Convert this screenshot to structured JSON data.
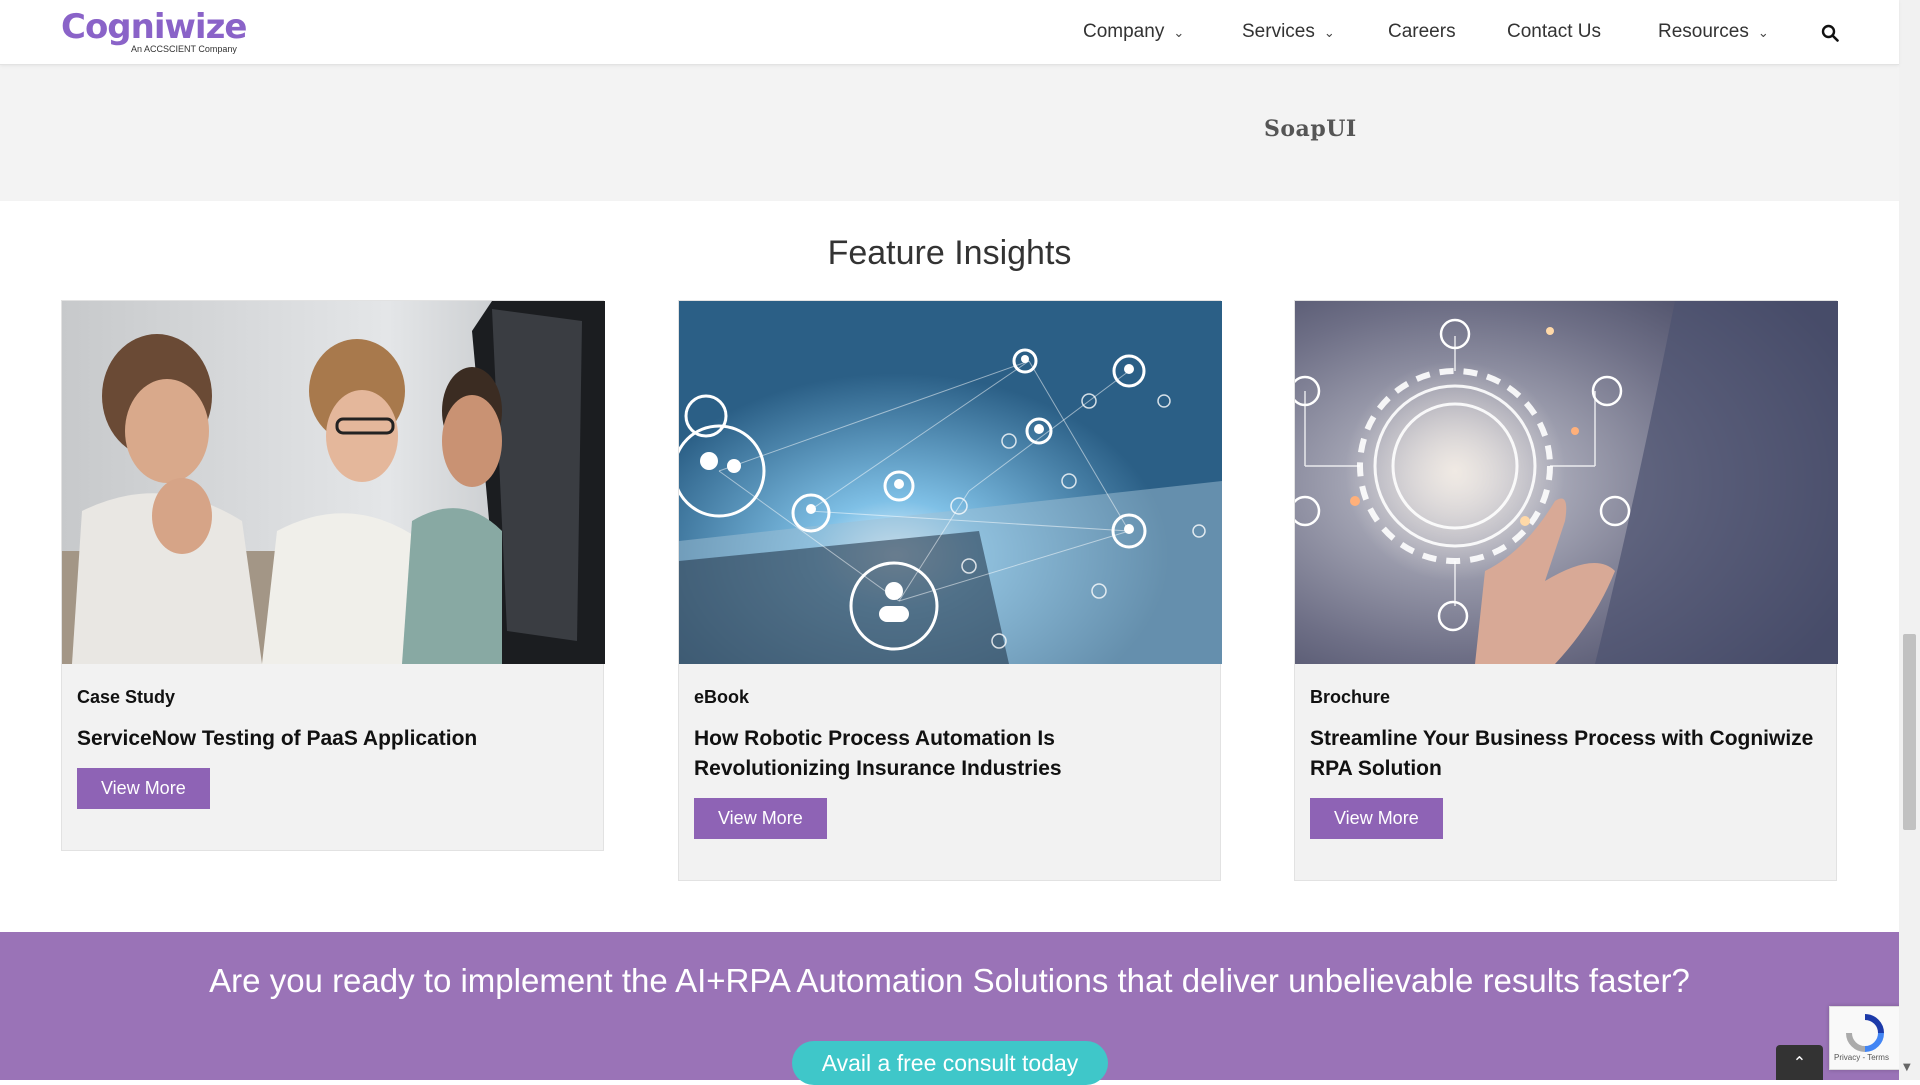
{
  "header": {
    "logo_text": "Cogniwize",
    "logo_subtext": "An ACCSCIENT Company",
    "nav": [
      {
        "label": "Company",
        "has_dropdown": true
      },
      {
        "label": "Services",
        "has_dropdown": true
      },
      {
        "label": "Careers",
        "has_dropdown": false
      },
      {
        "label": "Contact Us",
        "has_dropdown": false
      },
      {
        "label": "Resources",
        "has_dropdown": true
      }
    ],
    "search_icon": "search-icon"
  },
  "top_band": {
    "tool_label": "SoapUI"
  },
  "insights": {
    "title": "Feature Insights",
    "cards": [
      {
        "type": "Case Study",
        "title": "ServiceNow Testing of PaaS Application",
        "button": "View More",
        "image": "people-at-computer-photo"
      },
      {
        "type": "eBook",
        "title": "How Robotic Process Automation Is Revolutionizing Insurance Industries",
        "button": "View More",
        "image": "network-user-icons-photo"
      },
      {
        "type": "Brochure",
        "title": "Streamline Your Business Process with Cogniwize RPA Solution",
        "button": "View More",
        "image": "hand-holding-gear-photo"
      }
    ]
  },
  "cta": {
    "text": "Are you ready to implement the AI+RPA Automation Solutions that deliver unbelievable results faster?",
    "button": "Avail a free consult today"
  },
  "recaptcha": {
    "terms": "Privacy - Terms"
  },
  "colors": {
    "accent_purple": "#8e63b5",
    "cta_band": "#9a73b7",
    "cta_button": "#3fc7c9",
    "grey_band": "#f3f3f3"
  }
}
